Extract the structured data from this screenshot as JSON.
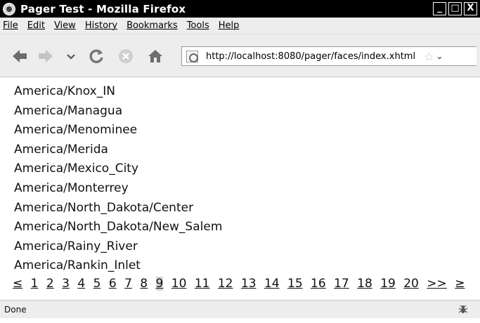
{
  "window": {
    "title": "Pager Test - Mozilla Firefox",
    "buttons": {
      "minimize": "_",
      "maximize": "□",
      "close": "X"
    }
  },
  "menubar": {
    "items": [
      "File",
      "Edit",
      "View",
      "History",
      "Bookmarks",
      "Tools",
      "Help"
    ]
  },
  "navbar": {
    "back_icon": "back-arrow-icon",
    "forward_icon": "forward-arrow-icon",
    "history_icon": "chevron-down-icon",
    "reload_icon": "reload-icon",
    "stop_icon": "stop-icon",
    "home_icon": "home-icon",
    "url": "http://localhost:8080/pager/faces/index.xhtml",
    "star": "☆",
    "dropdown": "⌄"
  },
  "content": {
    "zones": [
      "America/Knox_IN",
      "America/Managua",
      "America/Menominee",
      "America/Merida",
      "America/Mexico_City",
      "America/Monterrey",
      "America/North_Dakota/Center",
      "America/North_Dakota/New_Salem",
      "America/Rainy_River",
      "America/Rankin_Inlet"
    ]
  },
  "pager": {
    "first": "≤",
    "pages": [
      "1",
      "2",
      "3",
      "4",
      "5",
      "6",
      "7",
      "8",
      "9",
      "10",
      "11",
      "12",
      "13",
      "14",
      "15",
      "16",
      "17",
      "18",
      "19",
      "20"
    ],
    "current_page": "9",
    "next": ">>",
    "last": "≥"
  },
  "statusbar": {
    "text": "Done",
    "icon": "bug-icon"
  }
}
